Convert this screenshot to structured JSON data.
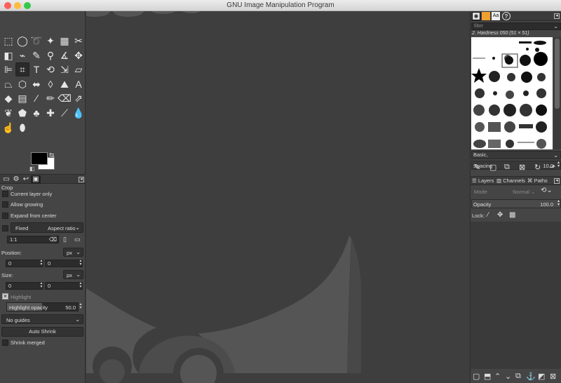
{
  "window": {
    "title": "GNU Image Manipulation Program",
    "controls": {
      "close_color": "#fc605c",
      "minimize_color": "#fdbc40",
      "zoom_color": "#34c84a"
    }
  },
  "toolbox": {
    "tools": [
      {
        "name": "rect-select-icon",
        "glyph": "⬚"
      },
      {
        "name": "ellipse-select-icon",
        "glyph": "◯"
      },
      {
        "name": "free-select-icon",
        "glyph": "➰"
      },
      {
        "name": "fuzzy-select-icon",
        "glyph": "✦"
      },
      {
        "name": "select-by-color-icon",
        "glyph": "▦"
      },
      {
        "name": "scissors-select-icon",
        "glyph": "✂"
      },
      {
        "name": "foreground-select-icon",
        "glyph": "◧"
      },
      {
        "name": "paths-icon",
        "glyph": "⌁"
      },
      {
        "name": "color-picker-icon",
        "glyph": "✎"
      },
      {
        "name": "zoom-icon",
        "glyph": "⚲"
      },
      {
        "name": "measure-icon",
        "glyph": "∡"
      },
      {
        "name": "move-icon",
        "glyph": "✥"
      },
      {
        "name": "align-icon",
        "glyph": "⊫"
      },
      {
        "name": "crop-icon",
        "glyph": "⌗"
      },
      {
        "name": "text-tool-icon",
        "glyph": "T"
      },
      {
        "name": "rotate-icon",
        "glyph": "⟲"
      },
      {
        "name": "scale-icon",
        "glyph": "⇲"
      },
      {
        "name": "shear-icon",
        "glyph": "▱"
      },
      {
        "name": "perspective-icon",
        "glyph": "⏢"
      },
      {
        "name": "3d-transform-icon",
        "glyph": "⬡"
      },
      {
        "name": "unified-transform-icon",
        "glyph": "⬌"
      },
      {
        "name": "warp-icon",
        "glyph": "◊"
      },
      {
        "name": "cage-icon",
        "glyph": "⛰"
      },
      {
        "name": "text-icon",
        "glyph": "A"
      },
      {
        "name": "bucket-fill-icon",
        "glyph": "◆"
      },
      {
        "name": "gradient-icon",
        "glyph": "▤"
      },
      {
        "name": "paintbrush-icon",
        "glyph": "∕"
      },
      {
        "name": "pencil-icon",
        "glyph": "✏"
      },
      {
        "name": "eraser-icon",
        "glyph": "⌫"
      },
      {
        "name": "airbrush-icon",
        "glyph": "⇗"
      },
      {
        "name": "mypaint-brush-icon",
        "glyph": "❦"
      },
      {
        "name": "ink-icon",
        "glyph": "⬟"
      },
      {
        "name": "clone-icon",
        "glyph": "♣"
      },
      {
        "name": "heal-icon",
        "glyph": "✚"
      },
      {
        "name": "perspective-clone-icon",
        "glyph": "⟋"
      },
      {
        "name": "blur-icon",
        "glyph": "💧"
      },
      {
        "name": "smudge-icon",
        "glyph": "☝"
      },
      {
        "name": "dodge-burn-icon",
        "glyph": "⬮"
      }
    ],
    "active_tool": "crop-icon",
    "tabs": [
      "tool-options-tab",
      "device-status-tab",
      "undo-history-tab",
      "images-tab"
    ]
  },
  "tool_options": {
    "title": "Crop",
    "current_layer_only": "Current layer only",
    "allow_growing": "Allow growing",
    "expand_from_center": "Expand from center",
    "fixed_label": "Fixed",
    "fixed_value": "Aspect ratio",
    "ratio_value": "1:1",
    "position_label": "Position:",
    "position_unit": "px",
    "position_x": "0",
    "position_y": "0",
    "size_label": "Size:",
    "size_unit": "px",
    "size_w": "0",
    "size_h": "0",
    "highlight_label": "Highlight",
    "highlight_opacity_label": "Highlight opacity",
    "highlight_opacity_value": "50.0",
    "guides_value": "No guides",
    "auto_shrink": "Auto Shrink",
    "shrink_merged": "Shrink merged"
  },
  "brushes": {
    "filter_placeholder": "filter",
    "current_brush": "2. Hardness 050 (51 × 51)",
    "tag_value": "Basic,",
    "spacing_label": "Spacing",
    "spacing_value": "10.0"
  },
  "layers": {
    "tabs": [
      "Layers",
      "Channels",
      "Paths"
    ],
    "mode_label": "Mode",
    "mode_value": "Normal",
    "opacity_label": "Opacity",
    "opacity_value": "100.0",
    "lock_label": "Lock:"
  }
}
